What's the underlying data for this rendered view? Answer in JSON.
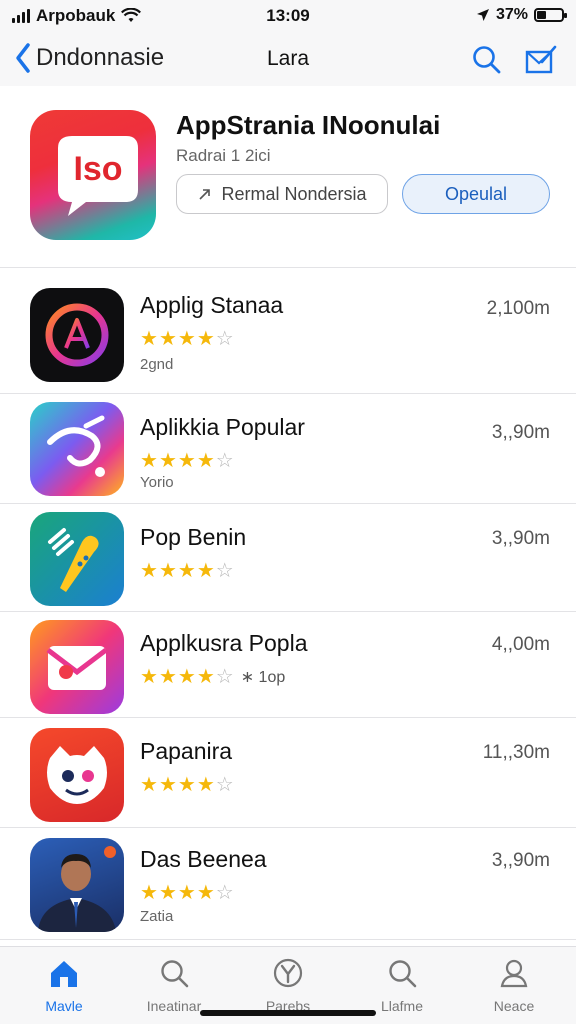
{
  "status_bar": {
    "carrier": "Arpobauk",
    "time": "13:09",
    "battery": "37%",
    "battery_level": 0.37
  },
  "nav": {
    "back_label": "Dndonnasie",
    "title": "Lara"
  },
  "featured": {
    "icon_text": "Iso",
    "title": "AppStrania INoonulai",
    "subtitle": "Radrai 1 2ici",
    "button_secondary": "Rermal Nondersia",
    "button_primary": "Opeulal"
  },
  "apps": [
    {
      "name": "Applig Stanaa",
      "rating": 4,
      "meta": "2gnd",
      "extra": "",
      "size": "2,100m"
    },
    {
      "name": "Aplikkia Popular",
      "rating": 4,
      "meta": "Yorio",
      "extra": "",
      "size": "3,,90m"
    },
    {
      "name": "Pop Benin",
      "rating": 4,
      "meta": "",
      "extra": "",
      "size": "3,,90m"
    },
    {
      "name": "Applkusra Popla",
      "rating": 4,
      "meta": "",
      "extra": "∗ 1op",
      "size": "4,,00m"
    },
    {
      "name": "Papanira",
      "rating": 4,
      "meta": "",
      "extra": "",
      "size": "11,,30m"
    },
    {
      "name": "Das Beenea",
      "rating": 4,
      "meta": "Zatia",
      "extra": "",
      "size": "3,,90m"
    }
  ],
  "tabs": [
    {
      "label": "Mavle",
      "icon": "home-icon",
      "active": true
    },
    {
      "label": "Ineatinar",
      "icon": "search-icon",
      "active": false
    },
    {
      "label": "Parebs",
      "icon": "y-badge-icon",
      "active": false
    },
    {
      "label": "Llafme",
      "icon": "search-icon",
      "active": false
    },
    {
      "label": "Neace",
      "icon": "person-icon",
      "active": false
    }
  ],
  "colors": {
    "accent": "#1a73e8",
    "star": "#f5b80b",
    "primary_button_bg": "#e9f1fb"
  }
}
